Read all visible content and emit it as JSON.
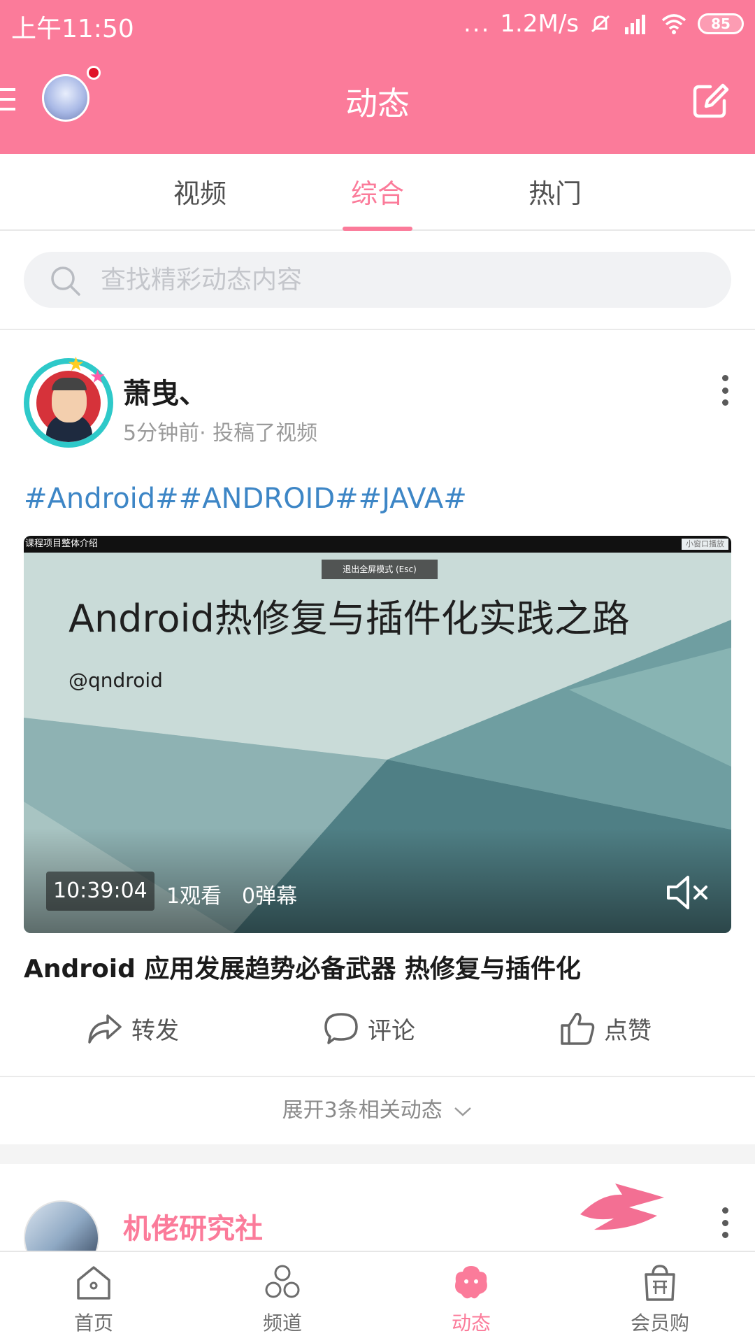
{
  "status_bar": {
    "time": "上午11:50",
    "dots": "...",
    "net_speed": "1.2M/s",
    "battery": "85"
  },
  "header": {
    "title": "动态"
  },
  "tabs": [
    {
      "label": "视频"
    },
    {
      "label": "综合"
    },
    {
      "label": "热门"
    }
  ],
  "active_tab": "综合",
  "search": {
    "placeholder": "查找精彩动态内容"
  },
  "post1": {
    "author": "萧曳、",
    "meta": "5分钟前· 投稿了视频",
    "tags": "#Android##ANDROID##JAVA#",
    "video": {
      "top_label": "课程项目整体介绍",
      "mini_label": "小窗口播放",
      "exit_label": "退出全屏模式 (Esc)",
      "slide_title": "Android热修复与插件化实践之路",
      "slide_sub": "@qndroid",
      "duration": "10:39:04",
      "views": "1观看",
      "danmaku": "0弹幕"
    },
    "title": "Android 应用发展趋势必备武器 热修复与插件化",
    "actions": {
      "share": "转发",
      "comment": "评论",
      "like": "点赞"
    },
    "expand": "展开3条相关动态"
  },
  "post2": {
    "author": "机佬研究社"
  },
  "bottom_nav": [
    {
      "label": "首页"
    },
    {
      "label": "频道"
    },
    {
      "label": "动态"
    },
    {
      "label": "会员购"
    }
  ],
  "colors": {
    "brand_pink": "#fb7b9a",
    "link_blue": "#3d86c6"
  }
}
